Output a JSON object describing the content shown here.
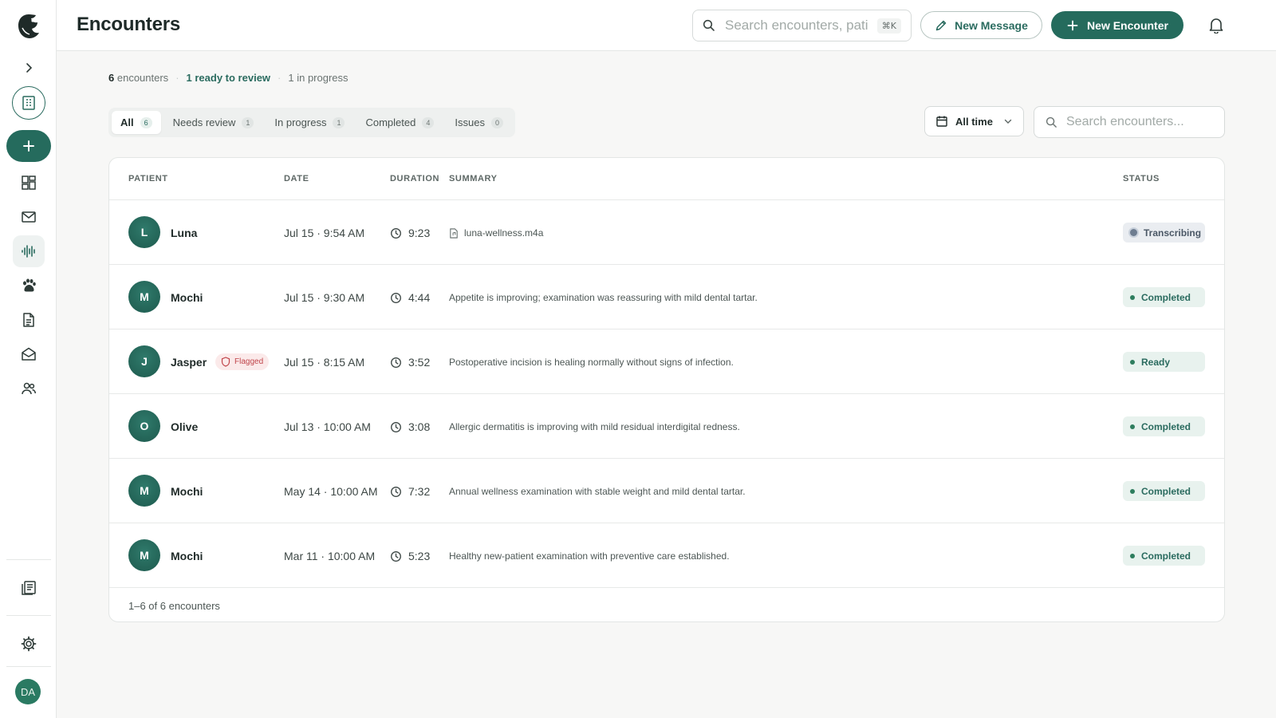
{
  "page": {
    "title": "Encounters"
  },
  "search": {
    "placeholder": "Search encounters, patients",
    "shortcut": "⌘K"
  },
  "actions": {
    "new_message": "New Message",
    "new_encounter": "New Encounter"
  },
  "sidebar": {
    "user_initials": "DA"
  },
  "stats": {
    "count": "6",
    "count_label": "encounters",
    "ready": "1 ready to review",
    "in_progress": "1 in progress"
  },
  "tabs": [
    {
      "label": "All",
      "count": "6"
    },
    {
      "label": "Needs review",
      "count": "1"
    },
    {
      "label": "In progress",
      "count": "1"
    },
    {
      "label": "Completed",
      "count": "4"
    },
    {
      "label": "Issues",
      "count": "0"
    }
  ],
  "filter": {
    "time": "All time"
  },
  "list_search": {
    "placeholder": "Search encounters..."
  },
  "table": {
    "headers": {
      "patient": "PATIENT",
      "date": "DATE",
      "duration": "DURATION",
      "summary": "SUMMARY",
      "status": "STATUS"
    },
    "rows": [
      {
        "initial": "L",
        "name": "Luna",
        "date": "Jul 15 · 9:54 AM",
        "duration": "9:23",
        "summary": "luna-wellness.m4a",
        "status": "Transcribing"
      },
      {
        "initial": "M",
        "name": "Mochi",
        "date": "Jul 15 · 9:30 AM",
        "duration": "4:44",
        "summary": "Appetite is improving; examination was reassuring with mild dental tartar.",
        "status": "Completed"
      },
      {
        "initial": "J",
        "name": "Jasper",
        "flag": "Flagged",
        "date": "Jul 15 · 8:15 AM",
        "duration": "3:52",
        "summary": "Postoperative incision is healing normally without signs of infection.",
        "status": "Ready"
      },
      {
        "initial": "O",
        "name": "Olive",
        "date": "Jul 13 · 10:00 AM",
        "duration": "3:08",
        "summary": "Allergic dermatitis is improving with mild residual interdigital redness.",
        "status": "Completed"
      },
      {
        "initial": "M",
        "name": "Mochi",
        "date": "May 14 · 10:00 AM",
        "duration": "7:32",
        "summary": "Annual wellness examination with stable weight and mild dental tartar.",
        "status": "Completed"
      },
      {
        "initial": "M",
        "name": "Mochi",
        "date": "Mar 11 · 10:00 AM",
        "duration": "5:23",
        "summary": "Healthy new-patient examination with preventive care established.",
        "status": "Completed"
      }
    ],
    "footer": "1–6 of 6 encounters"
  },
  "colors": {
    "accent": "#256b5d",
    "flag": "#c0444a"
  }
}
